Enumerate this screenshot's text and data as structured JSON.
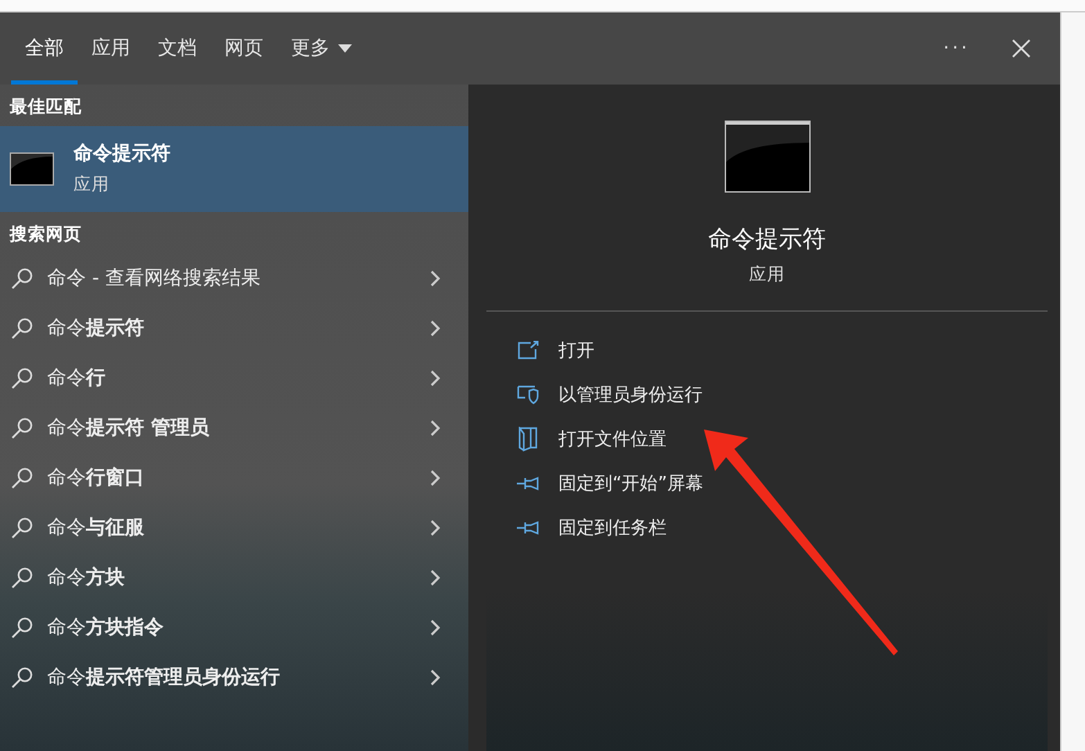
{
  "tabs": [
    {
      "label": "全部",
      "selected": true
    },
    {
      "label": "应用",
      "selected": false
    },
    {
      "label": "文档",
      "selected": false
    },
    {
      "label": "网页",
      "selected": false
    },
    {
      "label": "更多",
      "selected": false,
      "dropdown": true
    }
  ],
  "toolbar": {
    "more": "···"
  },
  "best_match": {
    "heading": "最佳匹配",
    "name": "命令提示符",
    "type": "应用",
    "selected": true
  },
  "web_search": {
    "heading": "搜索网页",
    "items": [
      {
        "text": "命令 - 查看网络搜索结果"
      },
      {
        "text": "命令**提示符**"
      },
      {
        "text": "命令**行**"
      },
      {
        "text": "命令**提示符 管理员**"
      },
      {
        "text": "命令**行窗口**"
      },
      {
        "text": "命令**与征服**"
      },
      {
        "text": "命令**方块**"
      },
      {
        "text": "命令**方块指令**"
      },
      {
        "text": "命令**提示符管理员身份运行**"
      }
    ]
  },
  "detail": {
    "name": "命令提示符",
    "type": "应用",
    "actions": [
      {
        "kind": "open",
        "label": "打开"
      },
      {
        "kind": "admin",
        "label": "以管理员身份运行"
      },
      {
        "kind": "folder",
        "label": "打开文件位置"
      },
      {
        "kind": "pin",
        "label": "固定到“开始”屏幕"
      },
      {
        "kind": "pin",
        "label": "固定到任务栏"
      }
    ]
  }
}
